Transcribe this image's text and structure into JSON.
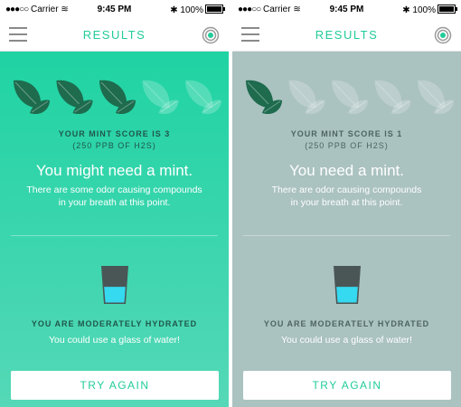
{
  "colors": {
    "accent": "#22cc99",
    "screen1_bg": "#2dd5a8",
    "screen2_bg": "#aac2c0",
    "leaf_dark": "#1e6b4e"
  },
  "screens": [
    {
      "status": {
        "carrier": "Carrier",
        "time": "9:45 PM",
        "battery": "100%"
      },
      "nav": {
        "title": "RESULTS",
        "menu_icon": "hamburger-icon",
        "right_icon": "target-icon"
      },
      "mint": {
        "score_label": "YOUR MINT SCORE IS 3",
        "ppb": "(250 PPB OF H2S)",
        "score": 3,
        "max": 5
      },
      "headline": "You might need a mint.",
      "desc_line1": "There are some odor causing compounds",
      "desc_line2": "in your breath at this point.",
      "hydration": {
        "label": "YOU ARE MODERATELY HYDRATED",
        "advice": "You could use a glass of water!",
        "level": 0.45
      },
      "button": "TRY AGAIN"
    },
    {
      "status": {
        "carrier": "Carrier",
        "time": "9:45 PM",
        "battery": "100%"
      },
      "nav": {
        "title": "RESULTS",
        "menu_icon": "hamburger-icon",
        "right_icon": "target-icon"
      },
      "mint": {
        "score_label": "YOUR MINT SCORE IS 1",
        "ppb": "(250 PPB OF H2S)",
        "score": 1,
        "max": 5
      },
      "headline": "You need a mint.",
      "desc_line1": "There are odor causing compounds",
      "desc_line2": "in your breath at this point.",
      "hydration": {
        "label": "YOU ARE MODERATELY HYDRATED",
        "advice": "You could use a glass of water!",
        "level": 0.45
      },
      "button": "TRY AGAIN"
    }
  ]
}
